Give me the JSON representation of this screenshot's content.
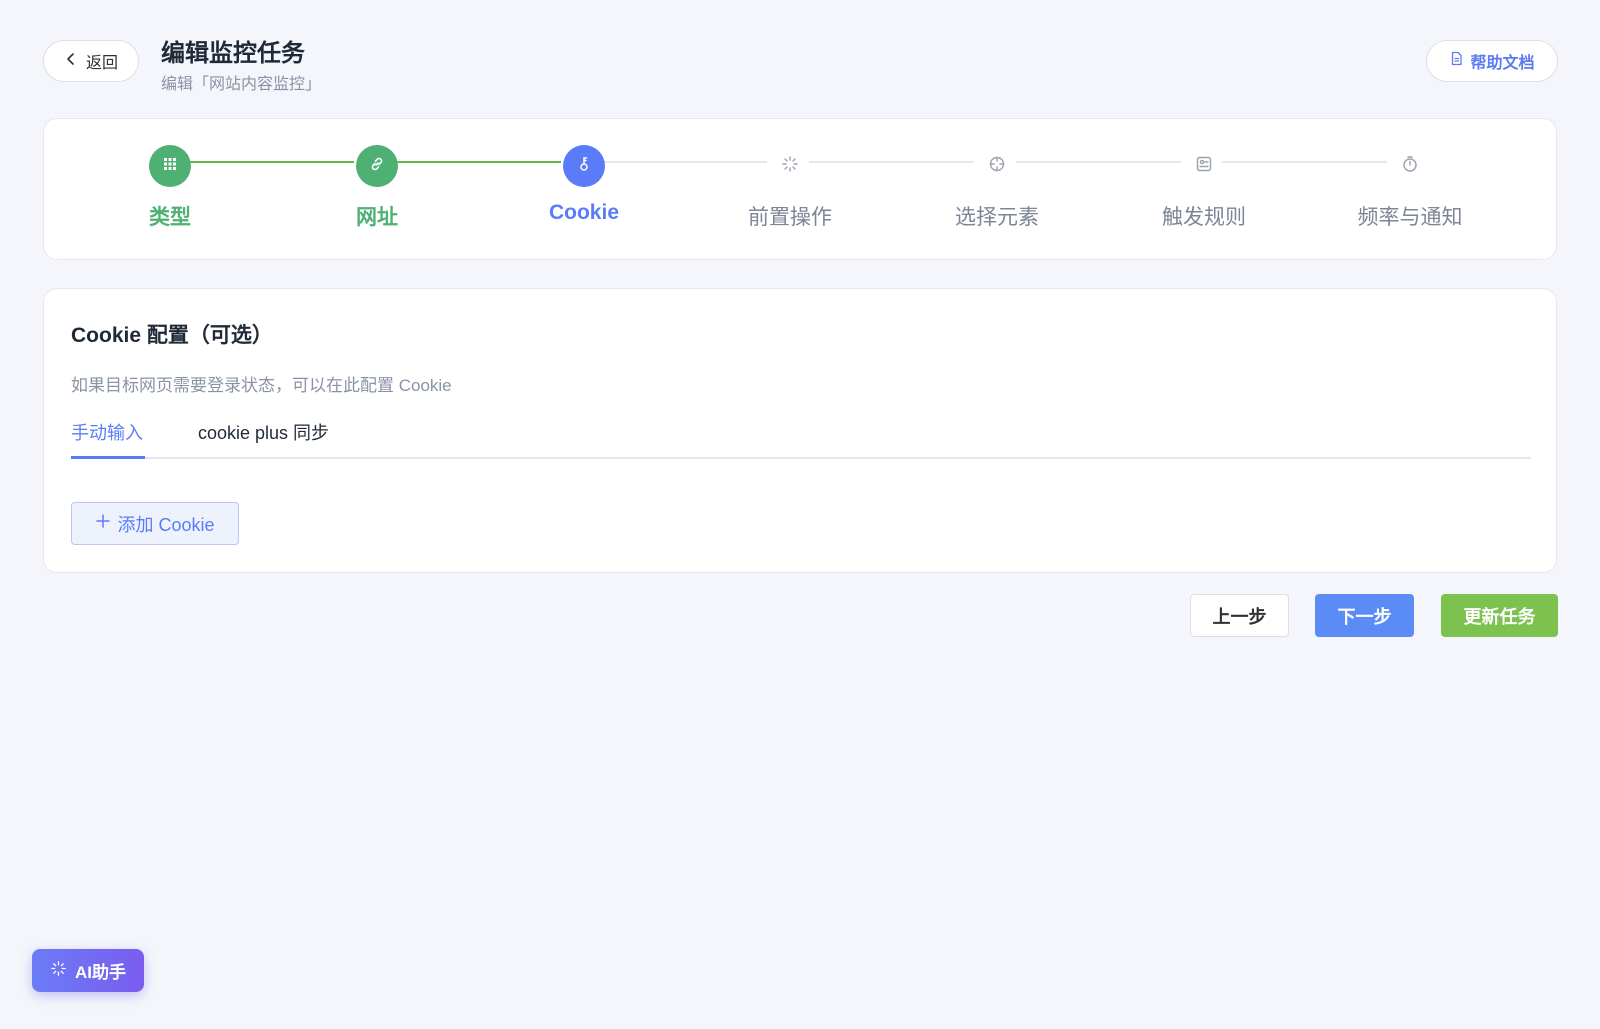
{
  "header": {
    "back_label": "返回",
    "title": "编辑监控任务",
    "subtitle": "编辑「网站内容监控」",
    "help_label": "帮助文档"
  },
  "steps": [
    {
      "label": "类型",
      "status": "done",
      "icon": "grid-icon"
    },
    {
      "label": "网址",
      "status": "done",
      "icon": "link-icon"
    },
    {
      "label": "Cookie",
      "status": "active",
      "icon": "key-icon"
    },
    {
      "label": "前置操作",
      "status": "pending",
      "icon": "spinner-icon"
    },
    {
      "label": "选择元素",
      "status": "pending",
      "icon": "crosshair-icon"
    },
    {
      "label": "触发规则",
      "status": "pending",
      "icon": "rule-icon"
    },
    {
      "label": "频率与通知",
      "status": "pending",
      "icon": "stopwatch-icon"
    }
  ],
  "cookie_config": {
    "title": "Cookie 配置（可选）",
    "description": "如果目标网页需要登录状态，可以在此配置 Cookie",
    "tabs": [
      {
        "label": "手动输入",
        "active": true
      },
      {
        "label": "cookie plus 同步",
        "active": false
      }
    ],
    "add_label": "添加 Cookie"
  },
  "actions": {
    "prev_label": "上一步",
    "next_label": "下一步",
    "update_label": "更新任务"
  },
  "ai_assistant": {
    "label": "AI助手"
  },
  "colors": {
    "primary": "#5b7cf8",
    "success": "#4fb074",
    "update": "#7dc24e",
    "background": "#f5f6fb"
  }
}
